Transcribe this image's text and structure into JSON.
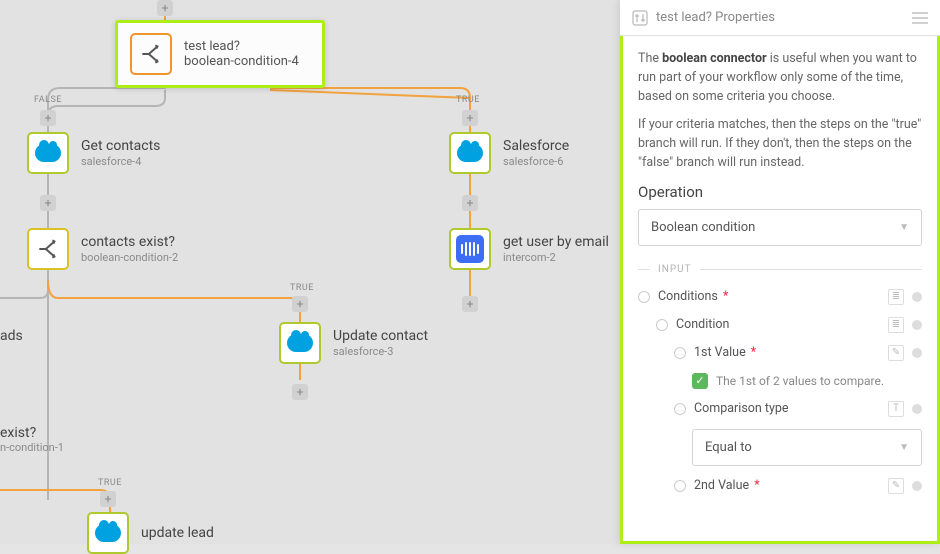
{
  "selected_node": {
    "title": "test lead?",
    "sub": "boolean-condition-4"
  },
  "nodes": {
    "get_contacts": {
      "title": "Get contacts",
      "sub": "salesforce-4"
    },
    "salesforce": {
      "title": "Salesforce",
      "sub": "salesforce-6"
    },
    "contacts_exist": {
      "title": "contacts exist?",
      "sub": "boolean-condition-2"
    },
    "get_user_email": {
      "title": "get user by email",
      "sub": "intercom-2"
    },
    "update_contact": {
      "title": "Update contact",
      "sub": "salesforce-3"
    },
    "update_lead": {
      "title": "update lead",
      "sub": ""
    },
    "ads": {
      "title": "ads",
      "sub": ""
    },
    "exist": {
      "title": "exist?",
      "sub": "n-condition-1"
    }
  },
  "labels": {
    "true": "TRUE",
    "false": "FALSE"
  },
  "panel": {
    "title": "test lead? Properties",
    "desc1a": "The ",
    "desc1b": "boolean connector",
    "desc1c": " is useful when you want to run part of your workflow only some of the time, based on some criteria you choose.",
    "desc2": "If your criteria matches, then the steps on the \"true\" branch will run. If they don't, then the steps on the \"false\" branch will run instead.",
    "operation_label": "Operation",
    "operation_value": "Boolean condition",
    "input_label": "INPUT",
    "conditions": "Conditions",
    "condition": "Condition",
    "first_value": "1st Value",
    "first_hint": "The 1st of 2 values to compare.",
    "comp_type": "Comparison type",
    "comp_value": "Equal to",
    "second_value": "2nd Value"
  }
}
